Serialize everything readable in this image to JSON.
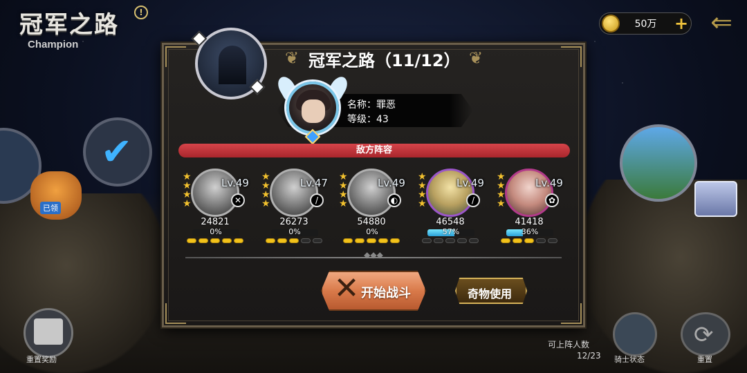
{
  "header": {
    "title_cn": "冠军之路",
    "title_en": "Champion",
    "info_icon": "info-icon",
    "currency_amount": "50万",
    "currency_plus": "+",
    "back_icon": "back-arrow-icon"
  },
  "map": {
    "reward_bag_label": "已领",
    "reset_reward_label": "重置奖励",
    "lineup_label": "可上阵人数",
    "lineup_count": "12/23",
    "knight_status_label": "骑士状态",
    "reset_label": "重置"
  },
  "dialog": {
    "title": "冠军之路（11/12）",
    "boss": {
      "name_line": "名称：罪恶",
      "level_line": "等级：43"
    },
    "banner": "敌方阵容",
    "heroes": [
      {
        "lv": "Lv.49",
        "power": "24821",
        "hp": "0%",
        "hp_value": 0,
        "pips_on": 5,
        "cls": "✕",
        "style": "gray"
      },
      {
        "lv": "Lv.47",
        "power": "26273",
        "hp": "0%",
        "hp_value": 0,
        "pips_on": 3,
        "cls": "/",
        "style": "gray"
      },
      {
        "lv": "Lv.49",
        "power": "54880",
        "hp": "0%",
        "hp_value": 0,
        "pips_on": 5,
        "cls": "◐",
        "style": "gray"
      },
      {
        "lv": "Lv.49",
        "power": "46548",
        "hp": "57%",
        "hp_value": 57,
        "pips_on": 0,
        "cls": "/",
        "style": "color1"
      },
      {
        "lv": "Lv.49",
        "power": "41418",
        "hp": "36%",
        "hp_value": 36,
        "pips_on": 3,
        "cls": "✿",
        "style": "color2"
      }
    ],
    "start_button": "开始战斗",
    "item_button": "奇物使用"
  }
}
